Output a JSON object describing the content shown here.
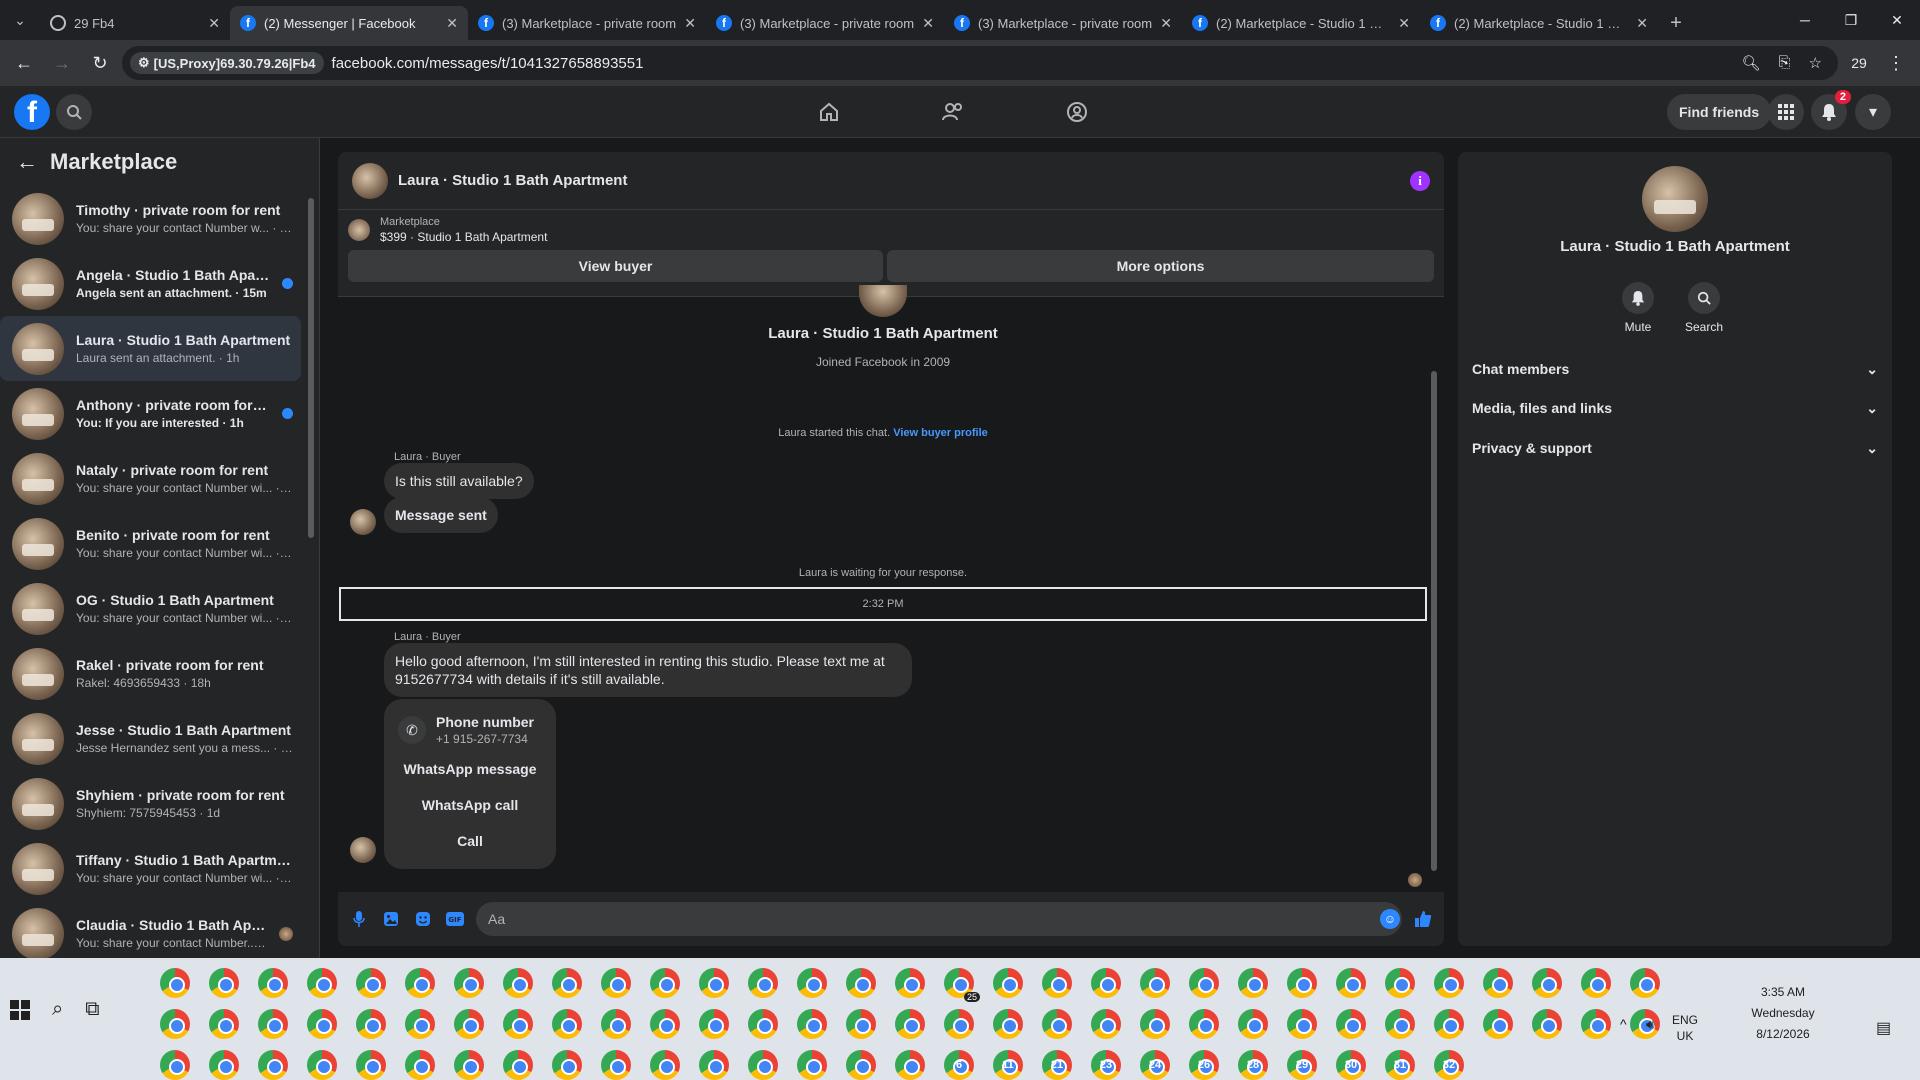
{
  "browser": {
    "tabs": [
      {
        "title": "29 Fb4",
        "favicon": "globe-icon",
        "active": false
      },
      {
        "title": "(2) Messenger | Facebook",
        "favicon": "facebook-icon",
        "active": true
      },
      {
        "title": "(3) Marketplace - private room",
        "favicon": "facebook-icon",
        "active": false
      },
      {
        "title": "(3) Marketplace - private room",
        "favicon": "facebook-icon",
        "active": false
      },
      {
        "title": "(3) Marketplace - private room",
        "favicon": "facebook-icon",
        "active": false
      },
      {
        "title": "(2) Marketplace - Studio 1 Bath",
        "favicon": "facebook-icon",
        "active": false
      },
      {
        "title": "(2) Marketplace - Studio 1 Bath",
        "favicon": "facebook-icon",
        "active": false
      }
    ],
    "proxy_chip": "[US,Proxy]69.30.79.26|Fb4",
    "url": "facebook.com/messages/t/1041327658893551",
    "profile_count": "29"
  },
  "header": {
    "find_friends": "Find friends",
    "notification_count": "2"
  },
  "sidebar": {
    "title": "Marketplace",
    "conversations": [
      {
        "name": "Timothy · private room for rent",
        "preview": "You: share your contact Number w... · 1m",
        "unread": false,
        "active": false
      },
      {
        "name": "Angela · Studio 1 Bath Apartm...",
        "preview": "Angela sent an attachment. · 15m",
        "unread": true,
        "active": false
      },
      {
        "name": "Laura · Studio 1 Bath Apartment",
        "preview": "Laura sent an attachment. · 1h",
        "unread": false,
        "active": true
      },
      {
        "name": "Anthony · private room for rent",
        "preview": "You: If you are interested · 1h",
        "unread": true,
        "active": false
      },
      {
        "name": "Nataly · private room for rent",
        "preview": "You: share your contact Number wi... · 2h",
        "unread": false,
        "active": false
      },
      {
        "name": "Benito · private room for rent",
        "preview": "You: share your contact Number wi... · 2h",
        "unread": false,
        "active": false
      },
      {
        "name": "OG · Studio 1 Bath Apartment",
        "preview": "You: share your contact Number wi... · 2h",
        "unread": false,
        "active": false
      },
      {
        "name": "Rakel · private room for rent",
        "preview": "Rakel: 4693659433 · 18h",
        "unread": false,
        "active": false
      },
      {
        "name": "Jesse · Studio 1 Bath Apartment",
        "preview": "Jesse Hernandez sent you a mess... · 21h",
        "unread": false,
        "active": false
      },
      {
        "name": "Shyhiem · private room for rent",
        "preview": "Shyhiem: 7575945453 · 1d",
        "unread": false,
        "active": false
      },
      {
        "name": "Tiffany · Studio 1 Bath Apartment",
        "preview": "You: share your contact Number wi... · 1d",
        "unread": false,
        "active": false
      },
      {
        "name": "Claudia · Studio 1 Bath Apart...",
        "preview": "You: share your contact Number... · 1d",
        "unread": false,
        "active": false
      }
    ]
  },
  "chat": {
    "title": "Laura · Studio 1 Bath Apartment",
    "listing_label": "Marketplace",
    "listing_title": "$399 · Studio 1 Bath Apartment",
    "view_buyer": "View buyer",
    "more_options": "More options",
    "profile_name": "Laura · Studio 1 Bath Apartment",
    "joined": "Joined Facebook in 2009",
    "started_note": "Laura started this chat.",
    "view_buyer_profile": "View buyer profile",
    "sender_label_1": "Laura · Buyer",
    "msg_1": "Is this still available?",
    "msg_2": "Message sent",
    "waiting_note": "Laura is waiting for your response.",
    "timestamp": "2:32 PM",
    "sender_label_2": "Laura · Buyer",
    "msg_3_line1": "Hello good afternoon, I'm still interested in renting this studio. Please text me at",
    "msg_3_line2": "9152677734 with details if it's still available.",
    "phone_title": "Phone number",
    "phone_number": "+1 915-267-7734",
    "whatsapp_message": "WhatsApp message",
    "whatsapp_call": "WhatsApp call",
    "call": "Call",
    "composer_placeholder": "Aa"
  },
  "details": {
    "name": "Laura · Studio 1 Bath Apartment",
    "mute": "Mute",
    "search": "Search",
    "sections": [
      "Chat members",
      "Media, files and links",
      "Privacy & support"
    ]
  },
  "taskbar": {
    "whatsapp_badge": "25",
    "numbered_icons": [
      "6",
      "11",
      "21",
      "23",
      "24",
      "26",
      "28",
      "29",
      "30",
      "31",
      "32"
    ],
    "time": "3:35 AM",
    "day": "Wednesday",
    "date": "8/12/2026",
    "lang_1": "ENG",
    "lang_2": "UK"
  },
  "colors": {
    "facebook_blue": "#1877f2",
    "link_blue": "#4599ff",
    "unread_dot": "#2d88ff",
    "info_purple": "#a033ff",
    "badge_red": "#e41e3f"
  }
}
